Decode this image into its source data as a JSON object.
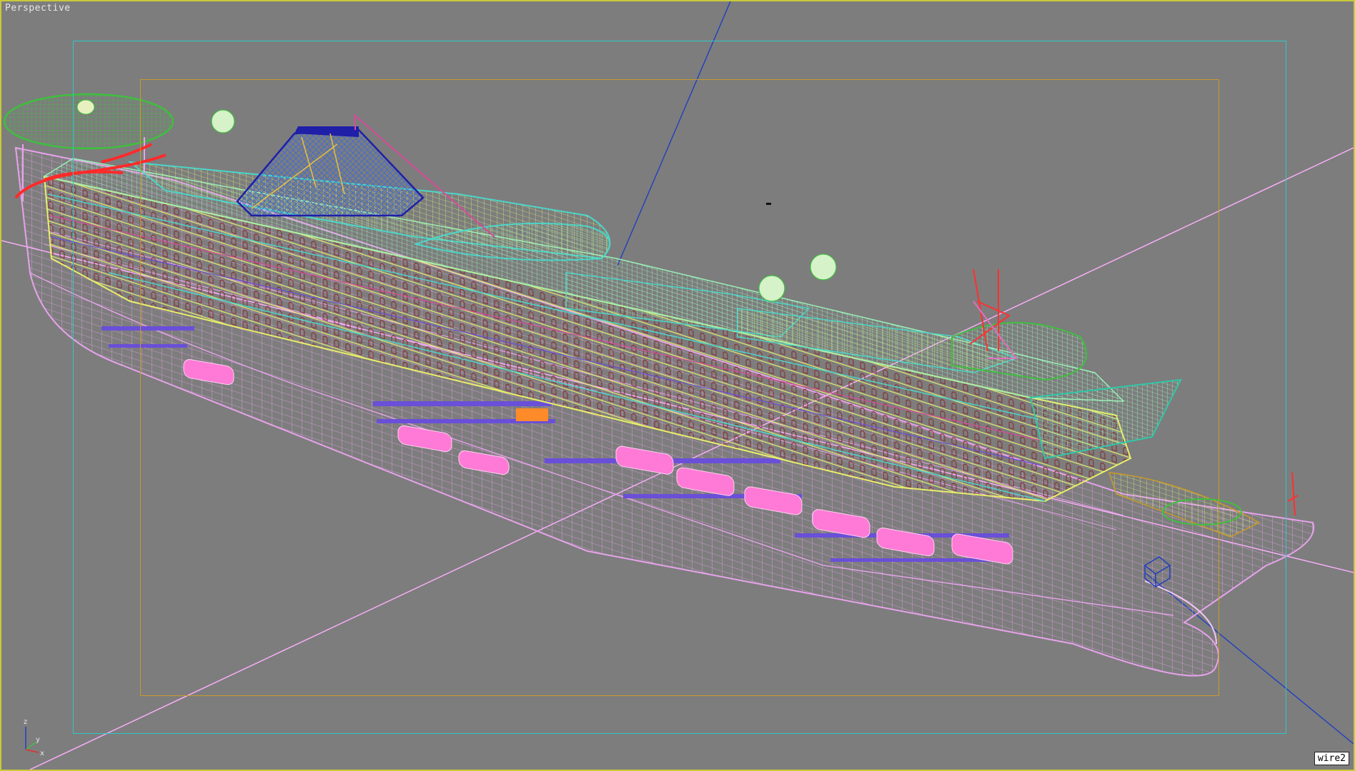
{
  "viewport": {
    "label": "Perspective",
    "name_tag": "wire2",
    "background_color": "#7d7d7d",
    "active_border_color": "#c9c93a"
  },
  "frames": {
    "safe_frame_outer_color": "#2fc8c8",
    "safe_frame_inner_color": "#c99a2a"
  },
  "axis_tripod": {
    "z_label": "z",
    "y_label": "y",
    "x_label": "x"
  },
  "scene": {
    "object": "cruise-ship-wireframe",
    "hull_color": "#e6a3ea",
    "deck_colors": [
      "#b6f58a",
      "#e8ef6a",
      "#4bd6c8",
      "#d84b9a",
      "#6a4fd8"
    ],
    "helipad_color": "#3fbf3f",
    "funnel_color": "#1f1fa8",
    "lifeboat_color": "#ff7ad6",
    "grid_axis_color": "#ffb0ff",
    "gizmo_axis_color": "#2040c0"
  }
}
